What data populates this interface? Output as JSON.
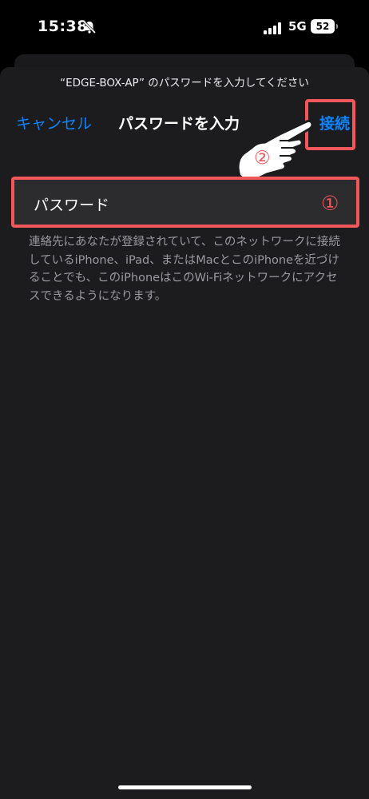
{
  "status_bar": {
    "time": "15:38",
    "network": "5G",
    "battery": "52",
    "icons": [
      "bell-slash-icon",
      "signal-bars-icon",
      "battery-icon"
    ]
  },
  "sheet": {
    "prompt": "“EDGE-BOX-AP” のパスワードを入力してください",
    "cancel_label": "キャンセル",
    "title": "パスワードを入力",
    "connect_label": "接続",
    "password_placeholder": "パスワード",
    "note": "連絡先にあなたが登録されていて、このネットワークに接続しているiPhone、iPad、またはMacとこのiPhoneを近づけることでも、このiPhoneはこのWi-Fiネットワークにアクセスできるようになります。"
  },
  "annotations": {
    "step1": "①",
    "step2": "②",
    "highlight_color": "#f0565a",
    "pointer_icon": "pointing-hand-icon"
  },
  "colors": {
    "accent": "#0a84ff",
    "background": "#1c1c1e",
    "field": "#2c2c2e"
  }
}
